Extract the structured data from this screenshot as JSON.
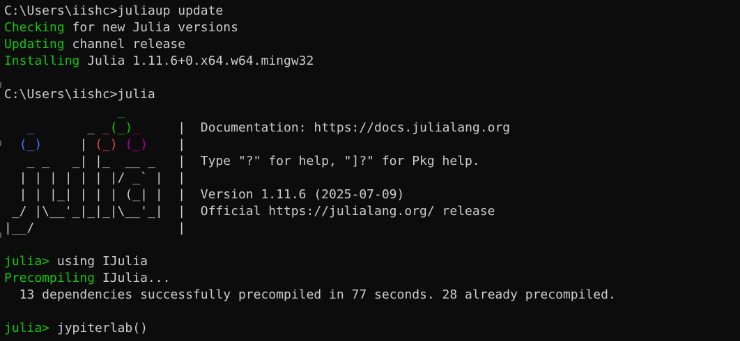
{
  "lines": [
    {
      "segments": [
        {
          "text": "C:\\Users\\iishc>juliaup update",
          "color": "default"
        }
      ]
    },
    {
      "segments": [
        {
          "text": "Checking",
          "color": "green"
        },
        {
          "text": " for new Julia versions",
          "color": "default"
        }
      ]
    },
    {
      "segments": [
        {
          "text": "Updating",
          "color": "green"
        },
        {
          "text": " channel release",
          "color": "default"
        }
      ]
    },
    {
      "segments": [
        {
          "text": "Installing",
          "color": "green"
        },
        {
          "text": " Julia 1.11.6+0.x64.w64.mingw32",
          "color": "default"
        }
      ]
    },
    {
      "segments": [
        {
          "text": "",
          "color": "default"
        }
      ]
    },
    {
      "segments": [
        {
          "text": "C:\\Users\\iishc>julia",
          "color": "default"
        }
      ]
    },
    {
      "segments": [
        {
          "text": "               ",
          "color": "default"
        },
        {
          "text": "_",
          "color": "green"
        }
      ]
    },
    {
      "segments": [
        {
          "text": "   ",
          "color": "default"
        },
        {
          "text": "_",
          "color": "blue"
        },
        {
          "text": "       _ ",
          "color": "default"
        },
        {
          "text": "_",
          "color": "red"
        },
        {
          "text": "(_)",
          "color": "green"
        },
        {
          "text": "_",
          "color": "purple"
        },
        {
          "text": "     |  Documentation: https://docs.julialang.org",
          "color": "default"
        }
      ]
    },
    {
      "segments": [
        {
          "text": "  ",
          "color": "default"
        },
        {
          "text": "(_)",
          "color": "blue"
        },
        {
          "text": "     | ",
          "color": "default"
        },
        {
          "text": "(_)",
          "color": "red"
        },
        {
          "text": " ",
          "color": "default"
        },
        {
          "text": "(_)",
          "color": "purple"
        },
        {
          "text": "    |",
          "color": "default"
        }
      ]
    },
    {
      "segments": [
        {
          "text": "   _ _   _| |_  __ _   |  Type \"?\" for help, \"]?\" for Pkg help.",
          "color": "default"
        }
      ]
    },
    {
      "segments": [
        {
          "text": "  | | | | | | |/ _` |  |",
          "color": "default"
        }
      ]
    },
    {
      "segments": [
        {
          "text": "  | | |_| | | | (_| |  |  Version 1.11.6 (2025-07-09)",
          "color": "default"
        }
      ]
    },
    {
      "segments": [
        {
          "text": " _/ |\\__'_|_|_|\\__'_|  |  Official https://julialang.org/ release",
          "color": "default"
        }
      ]
    },
    {
      "segments": [
        {
          "text": "|__/                   |",
          "color": "default"
        }
      ]
    },
    {
      "segments": [
        {
          "text": "",
          "color": "default"
        }
      ]
    },
    {
      "segments": [
        {
          "text": "julia>",
          "color": "green"
        },
        {
          "text": " using IJulia",
          "color": "default"
        }
      ]
    },
    {
      "segments": [
        {
          "text": "Precompiling",
          "color": "green"
        },
        {
          "text": " IJulia...",
          "color": "default"
        }
      ]
    },
    {
      "segments": [
        {
          "text": "  13 dependencies successfully precompiled in 77 seconds. 28 already precompiled.",
          "color": "default"
        }
      ]
    },
    {
      "segments": [
        {
          "text": "",
          "color": "default"
        }
      ]
    },
    {
      "segments": [
        {
          "text": "julia>",
          "color": "green"
        },
        {
          "text": " jypiterlab()",
          "color": "default"
        }
      ]
    }
  ],
  "colors": {
    "background": "#0c0c0c",
    "default": "#cccccc",
    "green": "#16c60c",
    "blue": "#3b78ff",
    "red": "#e74856",
    "purple": "#b4009e"
  }
}
